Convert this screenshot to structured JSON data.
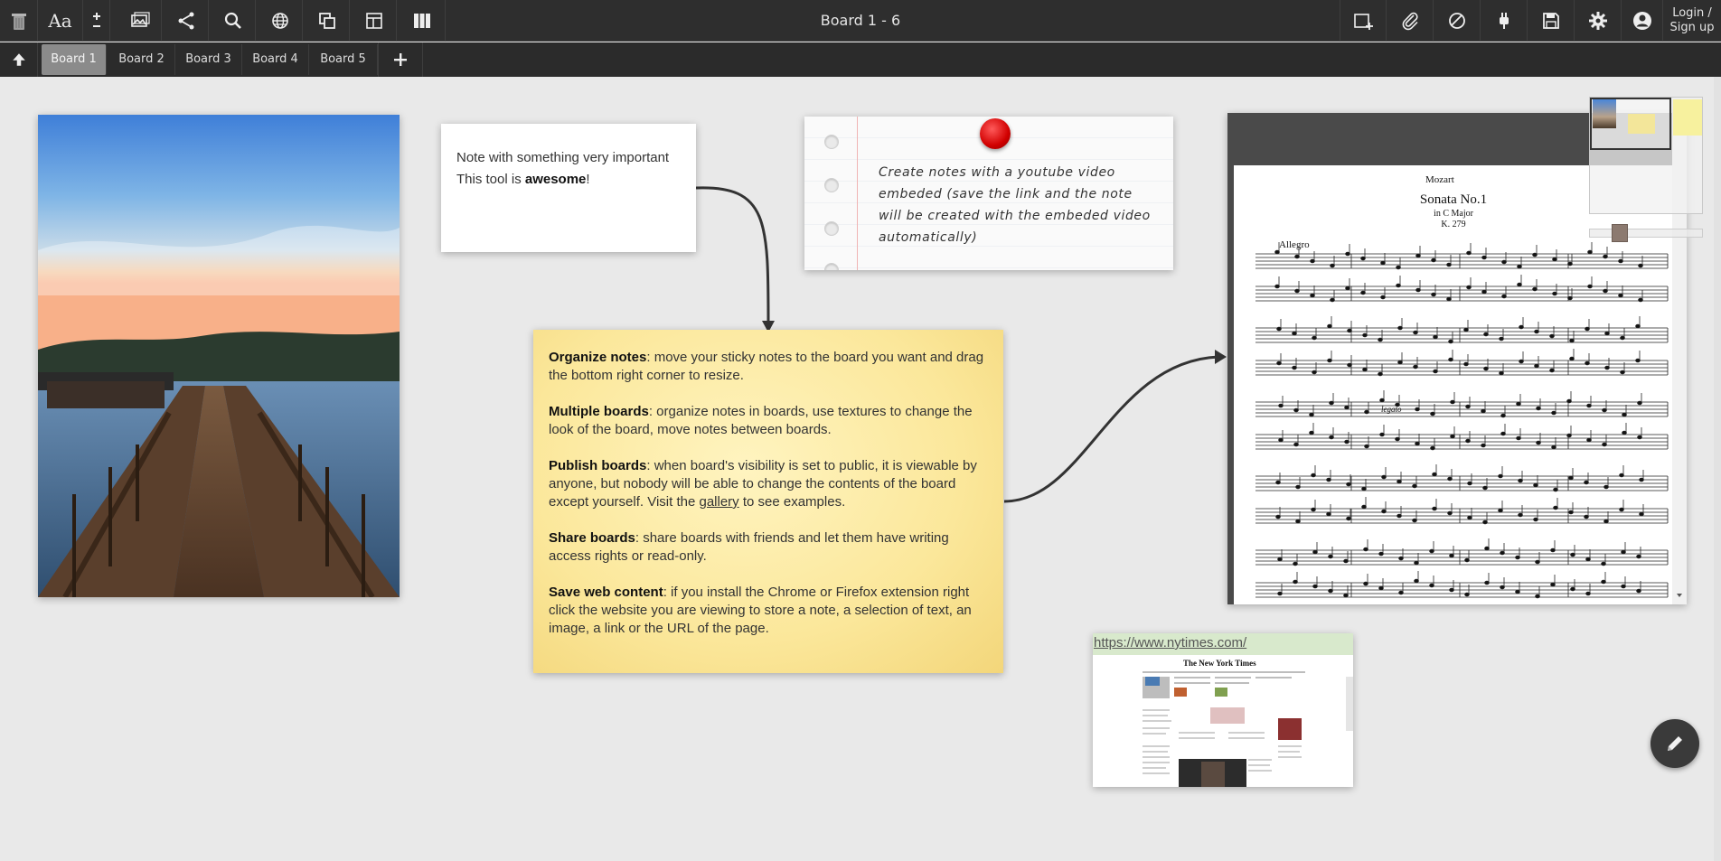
{
  "app": {
    "title": "Board 1 - 6",
    "login_label_line1": "Login /",
    "login_label_line2": "Sign up"
  },
  "toolbar_left": [
    {
      "icon": "trash-icon"
    },
    {
      "icon": "text-style-icon",
      "label": "Aa"
    },
    {
      "icon": "zoom-plus-minus-icon"
    },
    {
      "icon": "add-image-icon"
    },
    {
      "icon": "share-icon"
    },
    {
      "icon": "search-icon"
    },
    {
      "icon": "globe-icon"
    },
    {
      "icon": "copy-board-icon"
    },
    {
      "icon": "layout-icon"
    },
    {
      "icon": "columns-icon"
    }
  ],
  "toolbar_right": [
    {
      "icon": "add-note-icon"
    },
    {
      "icon": "paperclip-icon"
    },
    {
      "icon": "shape-icon"
    },
    {
      "icon": "plugin-icon"
    },
    {
      "icon": "save-icon"
    },
    {
      "icon": "gear-icon"
    },
    {
      "icon": "user-icon"
    }
  ],
  "tabs": [
    {
      "label": "Board 1",
      "active": true
    },
    {
      "label": "Board 2",
      "active": false
    },
    {
      "label": "Board 3",
      "active": false
    },
    {
      "label": "Board 4",
      "active": false
    },
    {
      "label": "Board 5",
      "active": false
    }
  ],
  "notes": {
    "white": {
      "line1": "Note with something very important",
      "line2_prefix": "This tool is ",
      "line2_bold": "awesome",
      "line2_suffix": "!"
    },
    "paper": {
      "text": "Create notes with a youtube video embeded (save the link and the note will be created with the embeded video automatically)"
    },
    "yellow": {
      "sections": [
        {
          "title": "Organize notes",
          "body": ": move your sticky notes to the board you want and drag the bottom right corner to resize."
        },
        {
          "title": "Multiple boards",
          "body": ": organize notes in boards, use textures to change the look of the board, move notes between boards."
        },
        {
          "title": "Publish boards",
          "body": ": when board's visibility is set to public, it is viewable by anyone, but nobody will be able to change the contents of the board except yourself. Visit the ",
          "link": "gallery",
          "body_after": " to see examples."
        },
        {
          "title": "Share boards",
          "body": ": share boards with friends and let them have writing access rights or read-only."
        },
        {
          "title": "Save web content",
          "body": ": if you install the Chrome or Firefox extension right click the website you are viewing to store a note, a selection of text, an image, a link or the URL of the page."
        }
      ]
    },
    "music": {
      "composer": "Mozart",
      "title": "Sonata No.1",
      "key": "in C Major",
      "catalog": "K. 279",
      "tempo": "Allegro",
      "marking": "legato"
    },
    "web": {
      "url": "https://www.nytimes.com/",
      "masthead": "The New York Times"
    }
  },
  "colors": {
    "toolbar_bg": "#2e2e2e",
    "board_bg": "#e9e9e9",
    "sticky_yellow": "#fbe79a",
    "pin_red": "#d10000",
    "web_link_bg": "#d8e9cc"
  }
}
